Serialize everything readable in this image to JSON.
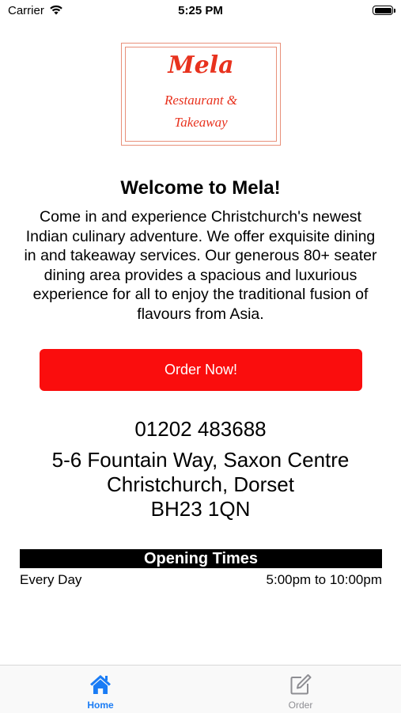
{
  "status_bar": {
    "carrier": "Carrier",
    "time": "5:25 PM",
    "icons": [
      "wifi-icon",
      "battery-icon"
    ]
  },
  "logo": {
    "title": "Mela",
    "subtitle_line1": "Restaurant &",
    "subtitle_line2": "Takeaway",
    "color": "#e8321e",
    "border_color": "#e8907a"
  },
  "welcome": {
    "heading": "Welcome to Mela!",
    "description": "Come in and experience Christchurch's newest Indian culinary adventure. We offer exquisite dining in and takeaway services. Our generous 80+ seater dining area provides a spacious and luxurious experience for all to enjoy the traditional fusion of flavours from Asia."
  },
  "order_button": {
    "label": "Order Now!",
    "color": "#fa0d0d"
  },
  "contact": {
    "phone": "01202 483688",
    "address_line1": "5-6 Fountain Way, Saxon Centre",
    "address_line2": "Christchurch, Dorset",
    "address_line3": "BH23 1QN"
  },
  "opening_times": {
    "header": "Opening Times",
    "rows": [
      {
        "day": "Every Day",
        "hours": "5:00pm to 10:00pm"
      }
    ]
  },
  "tab_bar": {
    "tabs": [
      {
        "label": "Home",
        "icon": "house-icon",
        "selected": true,
        "color": "#1a7cf5"
      },
      {
        "label": "Order",
        "icon": "edit-icon",
        "selected": false,
        "color": "#8e8e93"
      }
    ]
  }
}
